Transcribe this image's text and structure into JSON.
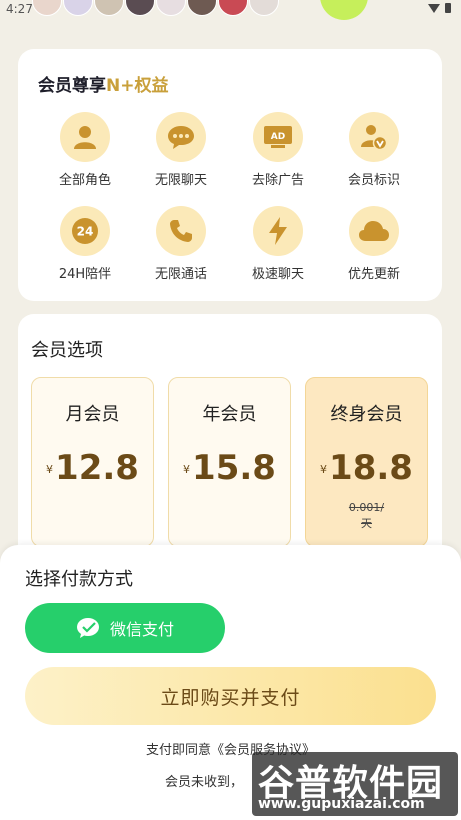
{
  "status_bar": {
    "time": "4:27"
  },
  "colors": {
    "accent_gold": "#c9a03b",
    "icon_bg": "#fbe9b8",
    "wechat_green": "#26cf6b",
    "price_brown": "#6b4a17"
  },
  "benefits": {
    "title_prefix": "会员尊享",
    "title_accent": "N+",
    "title_suffix": "权益",
    "items": [
      {
        "label": "全部角色",
        "icon": "person-icon"
      },
      {
        "label": "无限聊天",
        "icon": "chat-bubble-icon"
      },
      {
        "label": "去除广告",
        "icon": "ad-icon"
      },
      {
        "label": "会员标识",
        "icon": "vip-badge-icon"
      },
      {
        "label": "24H陪伴",
        "icon": "24h-icon"
      },
      {
        "label": "无限通话",
        "icon": "phone-icon"
      },
      {
        "label": "极速聊天",
        "icon": "lightning-icon"
      },
      {
        "label": "优先更新",
        "icon": "cloud-icon"
      }
    ]
  },
  "plans": {
    "title": "会员选项",
    "currency": "¥",
    "items": [
      {
        "name": "月会员",
        "price": "12.8",
        "daily": ""
      },
      {
        "name": "年会员",
        "price": "15.8",
        "daily": ""
      },
      {
        "name": "终身会员",
        "price": "18.8",
        "daily_line1": "0.001/",
        "daily_line2": "天",
        "selected": true
      }
    ]
  },
  "payment": {
    "title": "选择付款方式",
    "wechat_label": "微信支付",
    "buy_label": "立即购买并支付",
    "agreement": "支付即同意《会员服务协议》",
    "support": "会员未收到，"
  },
  "watermark": {
    "text": "谷普软件园",
    "url": "www.gupuxiazai.com"
  }
}
